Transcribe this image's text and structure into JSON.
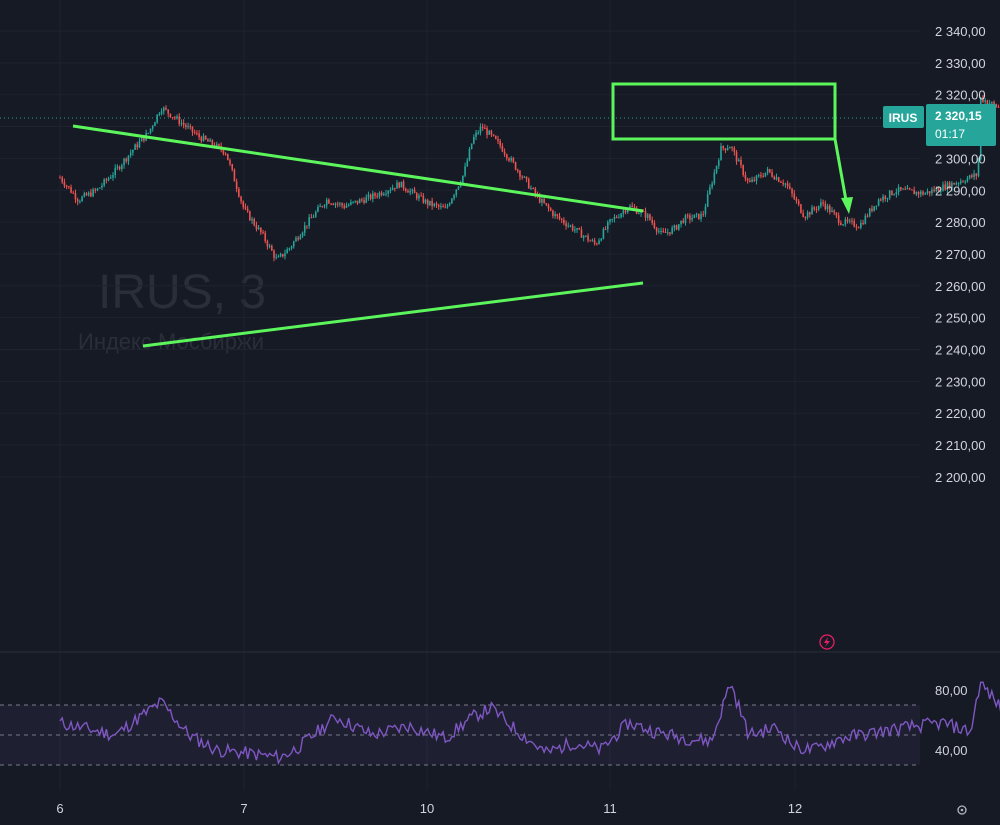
{
  "chart_data": [
    {
      "type": "candlestick",
      "symbol": "IRUS",
      "timeframe": "3",
      "watermark": "IRUS, 3",
      "watermark_subtitle": "Индекс Мосбиржи",
      "price_axis_labels": [
        "2 340,00",
        "2 330,00",
        "2 320,00",
        "2 310,00",
        "2 300,00",
        "2 290,00",
        "2 280,00",
        "2 270,00",
        "2 260,00",
        "2 250,00",
        "2 240,00",
        "2 230,00",
        "2 220,00",
        "2 210,00",
        "2 200,00"
      ],
      "ylim": [
        2193,
        2343
      ],
      "time_axis_labels": [
        "6",
        "7",
        "10",
        "11",
        "12"
      ],
      "last_price": "2 320,15",
      "countdown": "01:17",
      "price_path": [
        [
          0,
          2294
        ],
        [
          0.1,
          2287
        ],
        [
          0.2,
          2290
        ],
        [
          0.3,
          2296
        ],
        [
          0.4,
          2303
        ],
        [
          0.48,
          2308
        ],
        [
          0.55,
          2316
        ],
        [
          0.62,
          2313
        ],
        [
          0.75,
          2307
        ],
        [
          0.9,
          2302
        ],
        [
          1.0,
          2284
        ],
        [
          1.1,
          2276
        ],
        [
          1.18,
          2268
        ],
        [
          1.25,
          2272
        ],
        [
          1.35,
          2280
        ],
        [
          1.45,
          2287
        ],
        [
          1.55,
          2285
        ],
        [
          1.7,
          2288
        ],
        [
          1.85,
          2292
        ],
        [
          2.0,
          2286
        ],
        [
          2.1,
          2284
        ],
        [
          2.2,
          2295
        ],
        [
          2.25,
          2306
        ],
        [
          2.3,
          2310
        ],
        [
          2.4,
          2304
        ],
        [
          2.5,
          2296
        ],
        [
          2.6,
          2288
        ],
        [
          2.7,
          2282
        ],
        [
          2.8,
          2278
        ],
        [
          2.92,
          2273
        ],
        [
          3.0,
          2280
        ],
        [
          3.1,
          2285
        ],
        [
          3.2,
          2282
        ],
        [
          3.28,
          2276
        ],
        [
          3.35,
          2278
        ],
        [
          3.4,
          2281
        ],
        [
          3.5,
          2282
        ],
        [
          3.6,
          2303
        ],
        [
          3.65,
          2304
        ],
        [
          3.75,
          2292
        ],
        [
          3.85,
          2296
        ],
        [
          3.95,
          2292
        ],
        [
          4.05,
          2282
        ],
        [
          4.15,
          2286
        ],
        [
          4.25,
          2280
        ],
        [
          4.35,
          2279
        ],
        [
          4.45,
          2287
        ],
        [
          4.55,
          2290
        ],
        [
          4.7,
          2289
        ],
        [
          4.85,
          2292
        ],
        [
          4.99,
          2295
        ],
        [
          5.0,
          2319
        ],
        [
          5.1,
          2316
        ],
        [
          5.2,
          2318
        ],
        [
          5.35,
          2316
        ],
        [
          5.5,
          2319
        ],
        [
          5.6,
          2317
        ],
        [
          5.7,
          2311
        ],
        [
          5.78,
          2309
        ],
        [
          5.85,
          2316
        ],
        [
          6.0,
          2319
        ],
        [
          6.1,
          2321
        ],
        [
          6.2,
          2318
        ],
        [
          6.35,
          2317
        ],
        [
          6.45,
          2318
        ],
        [
          6.55,
          2321
        ],
        [
          6.62,
          2319
        ],
        [
          6.7,
          2319
        ],
        [
          6.75,
          2330
        ],
        [
          6.8,
          2322
        ],
        [
          6.88,
          2317
        ],
        [
          6.95,
          2318
        ],
        [
          7.05,
          2318
        ]
      ],
      "rsi": {
        "labels": [
          "80,00",
          "40,00"
        ],
        "upper_band": 70,
        "middle": 50,
        "lower_band": 30,
        "path": [
          [
            0,
            58
          ],
          [
            0.3,
            50
          ],
          [
            0.55,
            72
          ],
          [
            0.7,
            50
          ],
          [
            0.85,
            40
          ],
          [
            1.0,
            38
          ],
          [
            1.2,
            35
          ],
          [
            1.3,
            42
          ],
          [
            1.5,
            62
          ],
          [
            1.7,
            50
          ],
          [
            1.9,
            56
          ],
          [
            2.1,
            48
          ],
          [
            2.25,
            62
          ],
          [
            2.35,
            68
          ],
          [
            2.5,
            52
          ],
          [
            2.65,
            38
          ],
          [
            2.8,
            45
          ],
          [
            2.95,
            40
          ],
          [
            3.1,
            58
          ],
          [
            3.25,
            52
          ],
          [
            3.4,
            48
          ],
          [
            3.55,
            46
          ],
          [
            3.65,
            85
          ],
          [
            3.75,
            50
          ],
          [
            3.9,
            55
          ],
          [
            4.0,
            42
          ],
          [
            4.1,
            40
          ],
          [
            4.25,
            48
          ],
          [
            4.45,
            52
          ],
          [
            4.6,
            55
          ],
          [
            4.8,
            58
          ],
          [
            4.95,
            52
          ],
          [
            5.0,
            85
          ],
          [
            5.1,
            70
          ],
          [
            5.2,
            52
          ],
          [
            5.35,
            55
          ],
          [
            5.5,
            50
          ],
          [
            5.65,
            45
          ],
          [
            5.75,
            40
          ],
          [
            5.9,
            55
          ],
          [
            6.05,
            60
          ],
          [
            6.15,
            52
          ],
          [
            6.25,
            58
          ],
          [
            6.4,
            50
          ],
          [
            6.55,
            48
          ],
          [
            6.65,
            58
          ],
          [
            6.72,
            72
          ],
          [
            6.8,
            48
          ],
          [
            6.88,
            42
          ],
          [
            6.95,
            48
          ],
          [
            7.05,
            52
          ]
        ]
      },
      "drawings": [
        "triangle-upper-line",
        "triangle-lower-line",
        "range-box",
        "breakdown-arrow"
      ]
    }
  ],
  "colors": {
    "background": "#161a25",
    "up": "#26a69a",
    "down": "#ef5350",
    "drawing": "#5cf65c",
    "rsi": "#7e57c2",
    "badge": "#26a69a"
  },
  "icons": {
    "alert": "lightning-icon",
    "settings": "settings-icon"
  }
}
